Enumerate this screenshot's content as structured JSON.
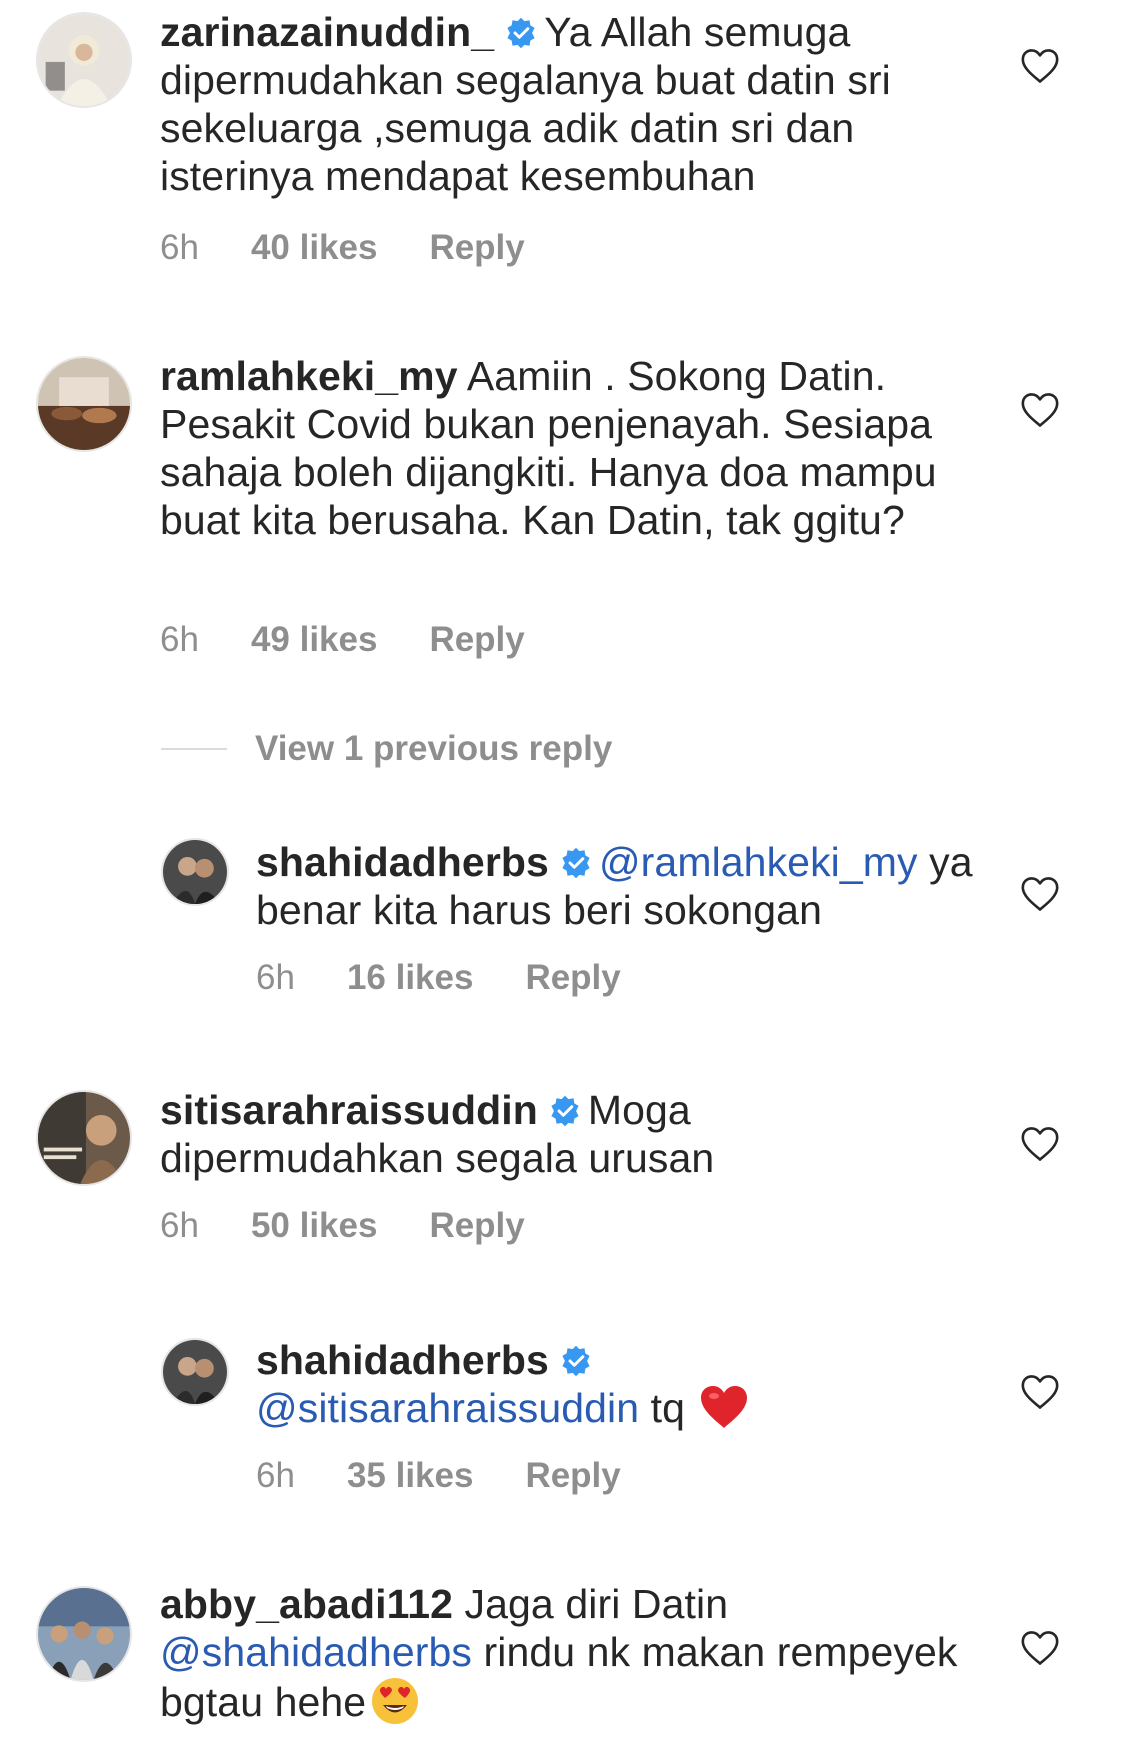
{
  "colors": {
    "text": "#262626",
    "meta": "#8e8e8e",
    "mention": "#2a5bb3",
    "verified": "#3897f0",
    "heart_emoji": "#e0242c",
    "divider": "#dbdbdb"
  },
  "comments": [
    {
      "username": "zarinazainuddin_",
      "verified": true,
      "text": "Ya Allah semuga dipermudahkan segalanya buat datin sri sekeluarga ,semuga adik datin sri  dan isterinya mendapat kesembuhan",
      "time": "6h",
      "likes": "40 likes",
      "reply_label": "Reply"
    },
    {
      "username": "ramlahkeki_my",
      "verified": false,
      "text": "Aamiin . Sokong Datin. Pesakit Covid bukan penjenayah. Sesiapa sahaja boleh dijangkiti. Hanya doa mampu buat kita berusaha. Kan Datin, tak ggitu?",
      "time": "6h",
      "likes": "49 likes",
      "reply_label": "Reply"
    },
    {
      "username": "shahidadherbs",
      "verified": true,
      "mention": "@ramlahkeki_my",
      "text": "ya benar kita harus beri sokongan",
      "time": "6h",
      "likes": "16 likes",
      "reply_label": "Reply"
    },
    {
      "username": "sitisarahraissuddin",
      "verified": true,
      "text": "Moga dipermudahkan segala urusan",
      "time": "6h",
      "likes": "50 likes",
      "reply_label": "Reply"
    },
    {
      "username": "shahidadherbs",
      "verified": true,
      "mention": "@sitisarahraissuddin",
      "text": "tq",
      "emoji": "red-heart",
      "time": "6h",
      "likes": "35 likes",
      "reply_label": "Reply"
    },
    {
      "username": "abby_abadi112",
      "verified": false,
      "text": "Jaga diri Datin",
      "mention": "@shahidadherbs",
      "text_after": "rindu nk makan rempeyek bgtau hehe",
      "emoji": "heart-eyes-face"
    }
  ],
  "view_replies_label": "View 1 previous reply",
  "icons": {
    "like": "heart-outline-icon",
    "verified": "verified-badge-icon"
  }
}
